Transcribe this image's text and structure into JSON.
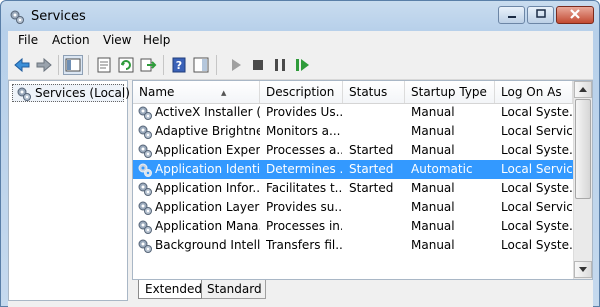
{
  "window": {
    "title": "Services"
  },
  "menu": [
    "File",
    "Action",
    "View",
    "Help"
  ],
  "left_pane": {
    "node": "Services (Local)"
  },
  "columns": [
    "Name",
    "Description",
    "Status",
    "Startup Type",
    "Log On As"
  ],
  "rows": [
    {
      "name": "ActiveX Installer (...",
      "description": "Provides Us...",
      "status": "",
      "startup": "Manual",
      "logon": "Local Syste..."
    },
    {
      "name": "Adaptive Brightness",
      "description": "Monitors a...",
      "status": "",
      "startup": "Manual",
      "logon": "Local Service"
    },
    {
      "name": "Application Experi...",
      "description": "Processes a...",
      "status": "Started",
      "startup": "Manual",
      "logon": "Local Syste..."
    },
    {
      "name": "Application Identity",
      "description": "Determines ...",
      "status": "Started",
      "startup": "Automatic",
      "logon": "Local Service"
    },
    {
      "name": "Application Infor...",
      "description": "Facilitates t...",
      "status": "Started",
      "startup": "Manual",
      "logon": "Local Syste..."
    },
    {
      "name": "Application Layer ...",
      "description": "Provides su...",
      "status": "",
      "startup": "Manual",
      "logon": "Local Service"
    },
    {
      "name": "Application Mana...",
      "description": "Processes in...",
      "status": "",
      "startup": "Manual",
      "logon": "Local Syste..."
    },
    {
      "name": "Background Intelli...",
      "description": "Transfers fil...",
      "status": "",
      "startup": "Manual",
      "logon": "Local Syste..."
    }
  ],
  "selected_row": "Application Identity",
  "tabs": [
    "Extended",
    "Standard"
  ],
  "colors": {
    "selection": "#3399ff",
    "window_frame": "#b7d0ea",
    "close_button": "#c24a32"
  }
}
